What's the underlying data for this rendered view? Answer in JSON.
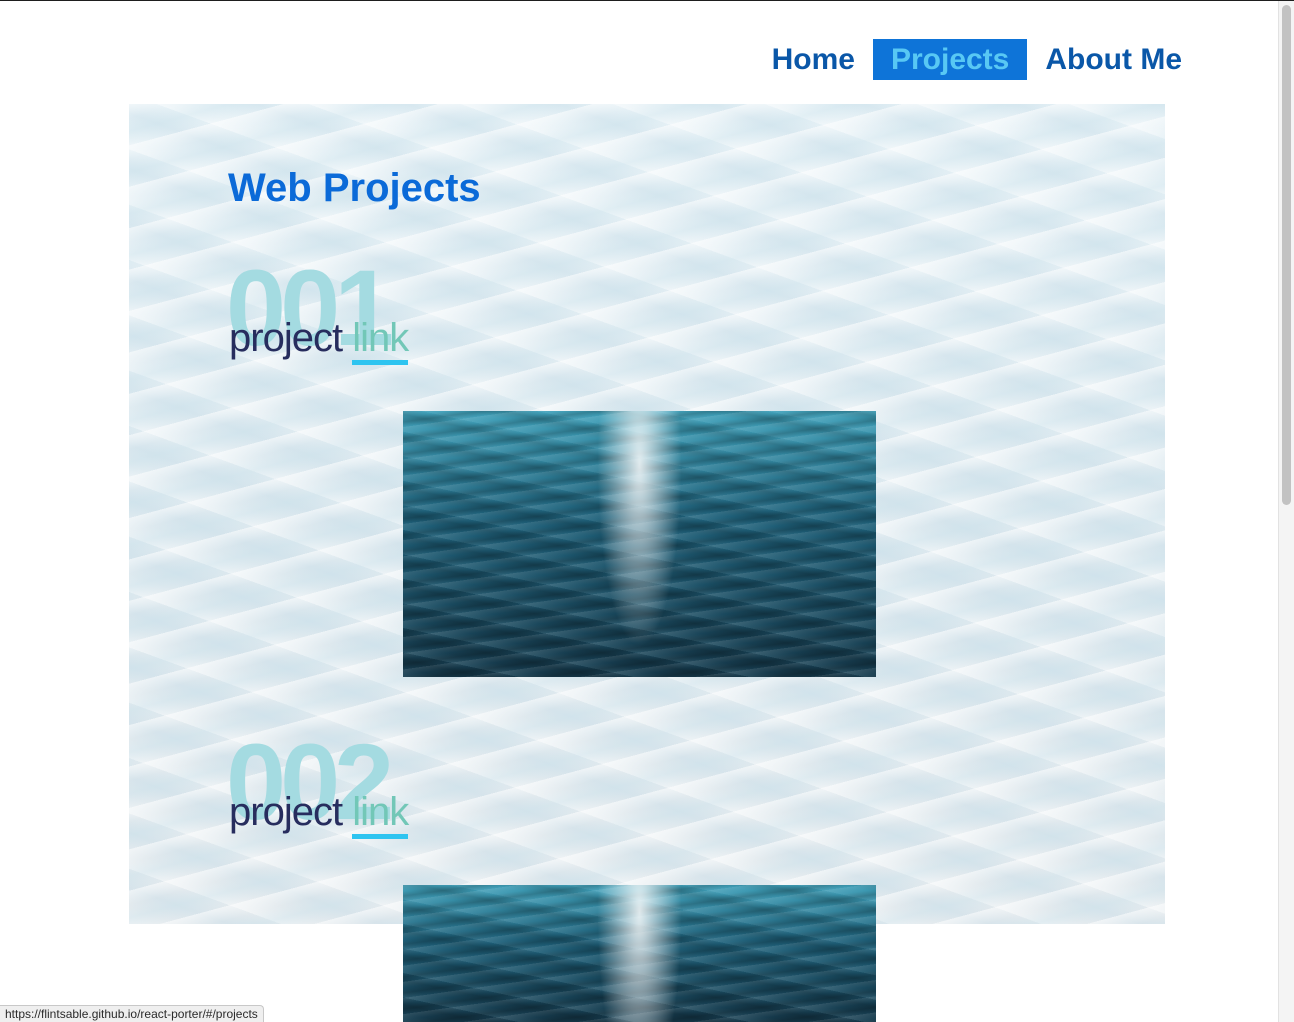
{
  "nav": {
    "items": [
      {
        "label": "Home",
        "active": false
      },
      {
        "label": "Projects",
        "active": true
      },
      {
        "label": "About Me",
        "active": false
      }
    ]
  },
  "main": {
    "title": "Web Projects",
    "projects": [
      {
        "number": "001",
        "label": "project",
        "link_text": "link"
      },
      {
        "number": "002",
        "label": "project",
        "link_text": "link"
      }
    ]
  },
  "status_bar": {
    "url": "https://flintsable.github.io/react-porter/#/projects"
  },
  "colors": {
    "nav_text": "#0a57a8",
    "nav_active_bg": "#0e74d8",
    "nav_active_text": "#58c8f4",
    "title": "#0b6ad8",
    "project_number": "#a4dbe1",
    "project_label": "#272d5e",
    "link_text": "#72c7b7",
    "link_underline": "#2ec4f0"
  }
}
